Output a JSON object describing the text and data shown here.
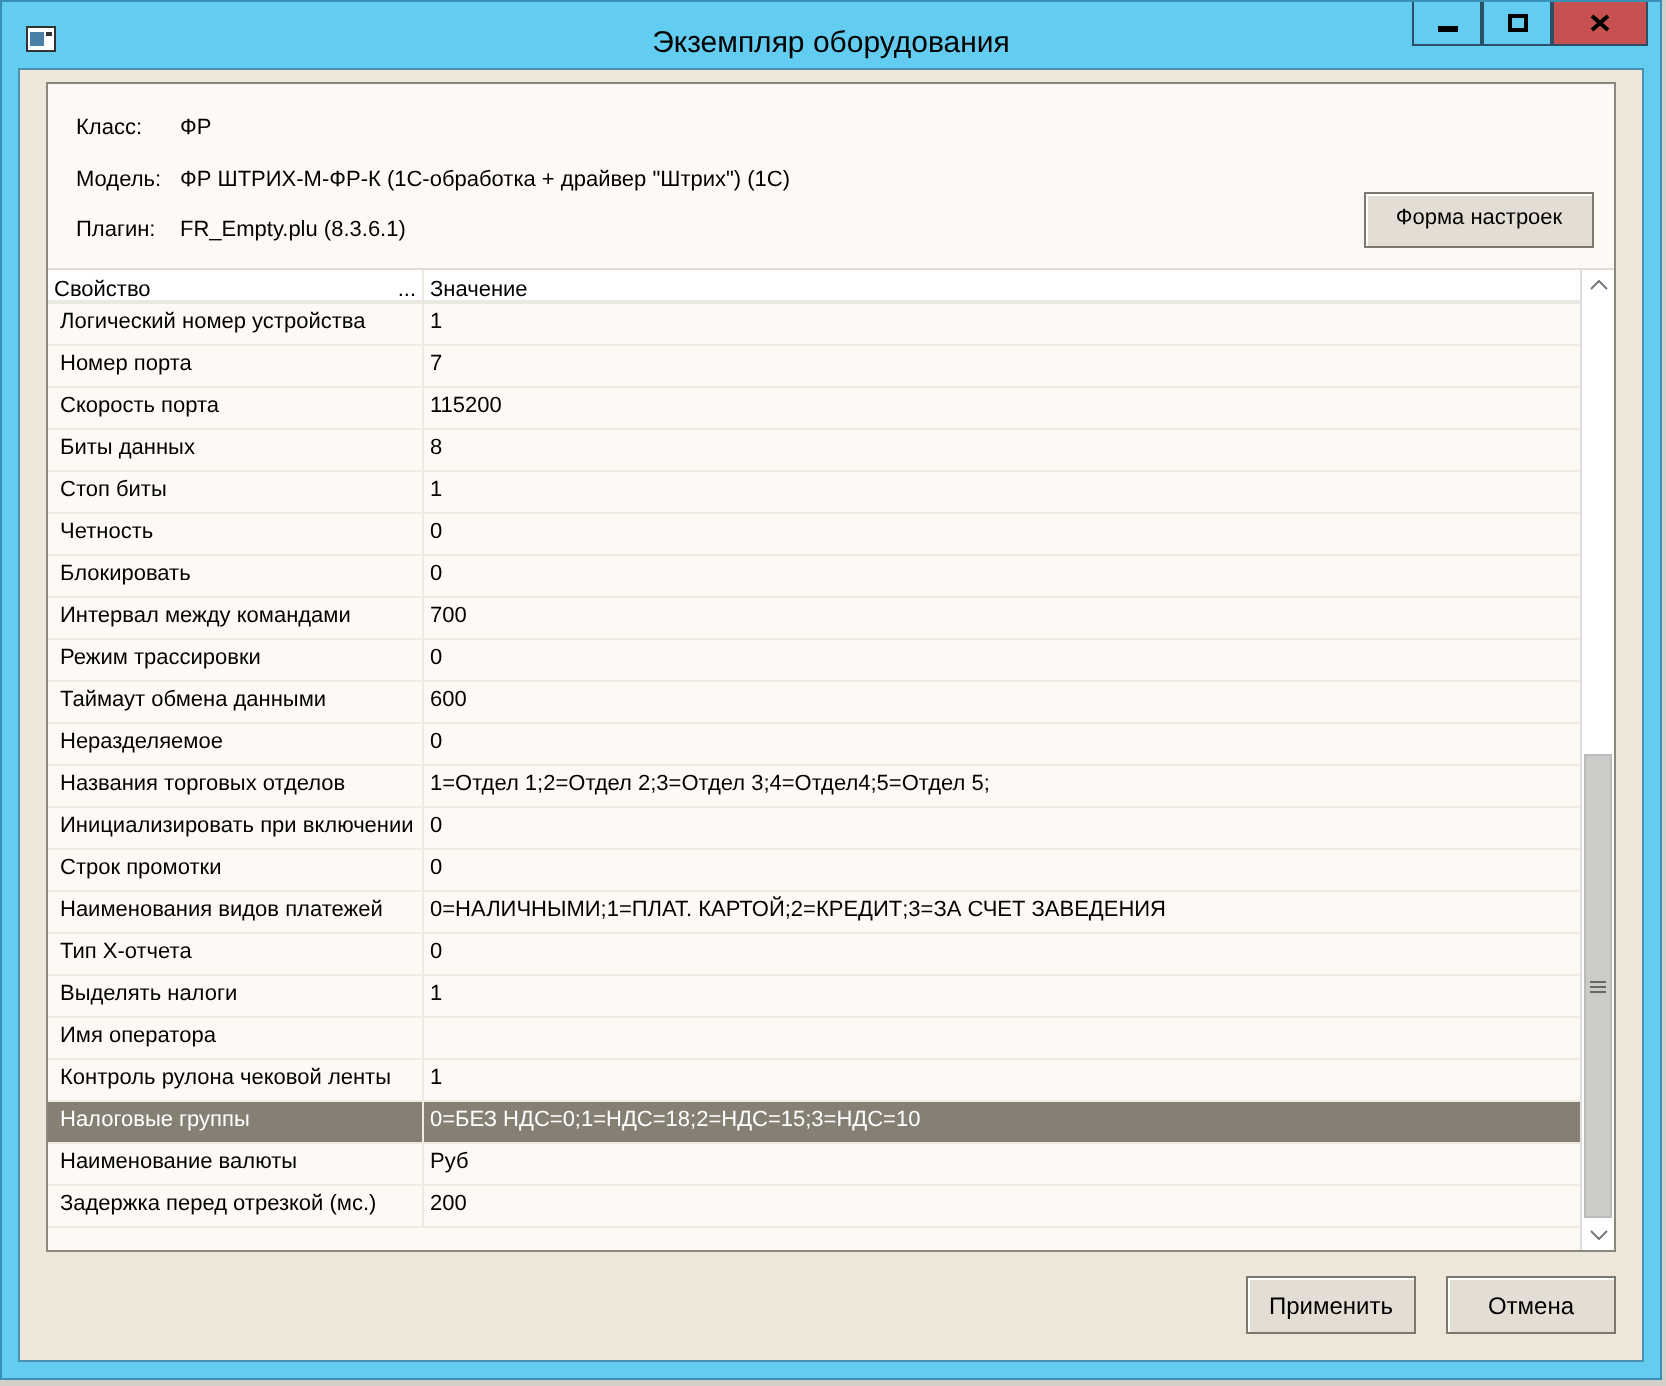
{
  "window": {
    "title": "Экземпляр оборудования"
  },
  "info": [
    {
      "label": "Класс:",
      "value": "ФР"
    },
    {
      "label": "Модель:",
      "value": "ФР ШТРИХ-М-ФР-К (1С-обработка + драйвер \"Штрих\") (1С)"
    },
    {
      "label": "Плагин:",
      "value": "FR_Empty.plu (8.3.6.1)"
    }
  ],
  "settings_button": "Форма настроек",
  "table": {
    "columns": [
      {
        "label": "Свойство",
        "menu": "..."
      },
      {
        "label": "Значение"
      }
    ],
    "rows": [
      {
        "property": "Логический номер устройства",
        "value": "1",
        "selected": false
      },
      {
        "property": "Номер порта",
        "value": "7",
        "selected": false
      },
      {
        "property": "Скорость порта",
        "value": "115200",
        "selected": false
      },
      {
        "property": "Биты данных",
        "value": "8",
        "selected": false
      },
      {
        "property": "Стоп биты",
        "value": "1",
        "selected": false
      },
      {
        "property": "Четность",
        "value": "0",
        "selected": false
      },
      {
        "property": "Блокировать",
        "value": "0",
        "selected": false
      },
      {
        "property": "Интервал между командами",
        "value": "700",
        "selected": false
      },
      {
        "property": "Режим трассировки",
        "value": "0",
        "selected": false
      },
      {
        "property": "Таймаут обмена данными",
        "value": "600",
        "selected": false
      },
      {
        "property": "Неразделяемое",
        "value": "0",
        "selected": false
      },
      {
        "property": "Названия торговых отделов",
        "value": "1=Отдел 1;2=Отдел 2;3=Отдел 3;4=Отдел4;5=Отдел 5;",
        "selected": false
      },
      {
        "property": "Инициализировать при включении",
        "value": "0",
        "selected": false
      },
      {
        "property": "Строк промотки",
        "value": "0",
        "selected": false
      },
      {
        "property": "Наименования видов платежей",
        "value": "0=НАЛИЧНЫМИ;1=ПЛАТ. КАРТОЙ;2=КРЕДИТ;3=ЗА СЧЕТ ЗАВЕДЕНИЯ",
        "selected": false
      },
      {
        "property": "Тип X-отчета",
        "value": "0",
        "selected": false
      },
      {
        "property": "Выделять налоги",
        "value": "1",
        "selected": false
      },
      {
        "property": "Имя оператора",
        "selected": false
      },
      {
        "property": "Контроль рулона чековой ленты",
        "value": "1",
        "selected": false
      },
      {
        "property": "Налоговые группы",
        "value": "0=БЕЗ НДС=0;1=НДС=18;2=НДС=15;3=НДС=10",
        "selected": true
      },
      {
        "property": "Наименование валюты",
        "value": "Руб",
        "selected": false
      },
      {
        "property": "Задержка перед отрезкой (мс.)",
        "value": "200",
        "selected": false
      }
    ]
  },
  "buttons": [
    "Применить",
    "Отмена"
  ]
}
